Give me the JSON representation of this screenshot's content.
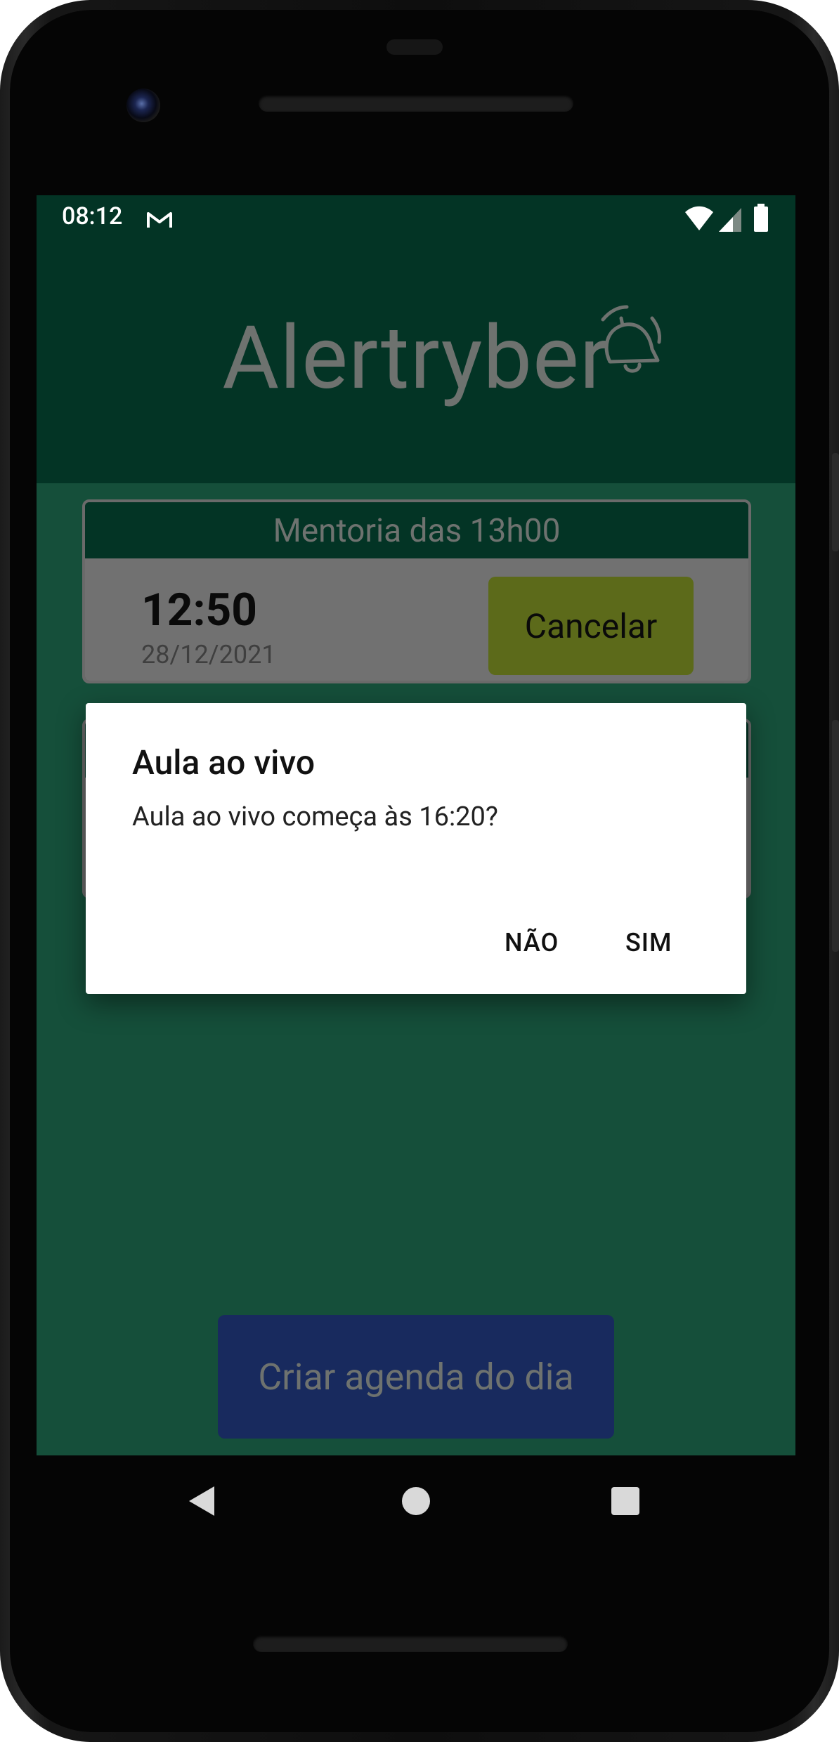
{
  "status_bar": {
    "time": "08:12",
    "notification_icon": "gmail-icon",
    "icons": [
      "wifi-icon",
      "cell-signal-icon",
      "battery-icon"
    ]
  },
  "header": {
    "app_name": "Alertryber",
    "logo_icon": "bell-icon"
  },
  "cards": [
    {
      "title": "Mentoria das 13h00",
      "time": "12:50",
      "date": "28/12/2021",
      "cancel_label": "Cancelar"
    }
  ],
  "dialog": {
    "title": "Aula ao vivo",
    "message": "Aula ao vivo começa às 16:20?",
    "negative_label": "NÃO",
    "positive_label": "SIM"
  },
  "footer": {
    "create_label": "Criar agenda do dia"
  },
  "colors": {
    "header_bg": "#033425",
    "screen_bg": "#154f3a",
    "cancel_button": "#5c6a1a",
    "create_button": "#182a5e",
    "dialog_bg": "#ffffff"
  },
  "navigation": {
    "buttons": [
      "back-icon",
      "home-icon",
      "recents-icon"
    ]
  }
}
